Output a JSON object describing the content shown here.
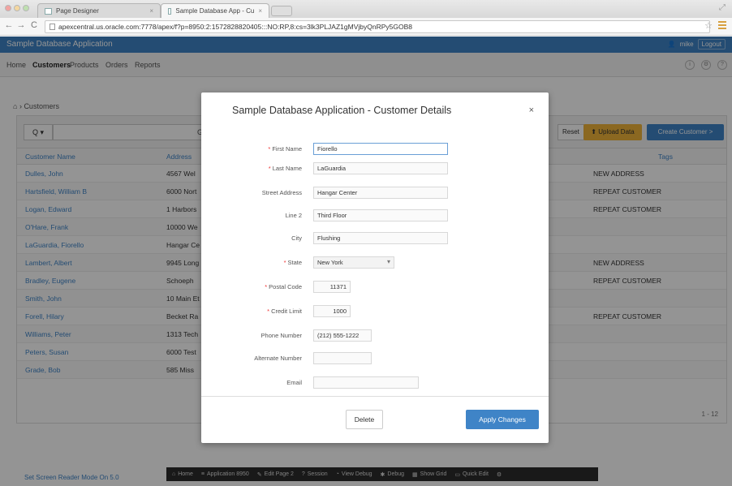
{
  "browser": {
    "tabs": [
      {
        "label": "Page Designer"
      },
      {
        "label": "Sample Database App - Cu"
      }
    ],
    "url": "apexcentral.us.oracle.com:7778/apex/f?p=8950:2:1572828820405:::NO:RP,8:cs=3lk3PLJAZ1gMVjbyQnRPy5GOB8"
  },
  "app": {
    "title": "Sample Database Application",
    "user": "mike",
    "logout": "Logout"
  },
  "nav": {
    "items": [
      "Home",
      "Customers",
      "Products",
      "Orders",
      "Reports"
    ],
    "active": "Customers"
  },
  "breadcrumb": "Customers",
  "report": {
    "search_button": "Q ▾",
    "go": "G",
    "reset": "Reset",
    "upload": "Upload Data",
    "create": "Create Customer >",
    "columns": [
      "Customer Name",
      "Address",
      "Tags"
    ],
    "rows": [
      {
        "name": "Dulles, John",
        "address": "4567 Wel",
        "tags": "NEW ADDRESS"
      },
      {
        "name": "Hartsfield, William B",
        "address": "6000 Nort",
        "tags": "REPEAT CUSTOMER"
      },
      {
        "name": "Logan, Edward",
        "address": "1 Harbors",
        "tags": "REPEAT CUSTOMER"
      },
      {
        "name": "O'Hare, Frank",
        "address": "10000 We",
        "tags": ""
      },
      {
        "name": "LaGuardia, Fiorello",
        "address": "Hangar Ce",
        "tags": ""
      },
      {
        "name": "Lambert, Albert",
        "address": "9945 Long",
        "tags": "NEW ADDRESS"
      },
      {
        "name": "Bradley, Eugene",
        "address": "Schoeph",
        "tags": "REPEAT CUSTOMER"
      },
      {
        "name": "Smith, John",
        "address": "10 Main Et",
        "tags": ""
      },
      {
        "name": "Forell, Hilary",
        "address": "Becket Ra",
        "tags": "REPEAT CUSTOMER"
      },
      {
        "name": "Williams, Peter",
        "address": "1313 Tech",
        "tags": ""
      },
      {
        "name": "Peters, Susan",
        "address": "6000 Test",
        "tags": ""
      },
      {
        "name": "Grade, Bob",
        "address": "585 Miss",
        "tags": ""
      }
    ],
    "pagination": "1 - 12"
  },
  "reader_link": "Set Screen Reader Mode On 5.0",
  "dialog": {
    "title": "Sample Database Application - Customer Details",
    "close": "×",
    "fields": [
      {
        "label": "First Name",
        "value": "Fiorello",
        "required": true
      },
      {
        "label": "Last Name",
        "value": "LaGuardia",
        "required": true
      },
      {
        "label": "Street Address",
        "value": "Hangar Center",
        "required": false
      },
      {
        "label": "Line 2",
        "value": "Third Floor",
        "required": false
      },
      {
        "label": "City",
        "value": "Flushing",
        "required": false
      },
      {
        "label": "State",
        "value": "New York",
        "required": true
      },
      {
        "label": "Postal Code",
        "value": "11371",
        "required": true
      },
      {
        "label": "Credit Limit",
        "value": "1000",
        "required": true
      },
      {
        "label": "Phone Number",
        "value": "(212) 555-1222",
        "required": false
      },
      {
        "label": "Alternate Number",
        "value": "",
        "required": false
      },
      {
        "label": "Email",
        "value": "",
        "required": false
      }
    ],
    "delete": "Delete",
    "apply": "Apply Changes"
  },
  "devbar": {
    "items": [
      "Home",
      "Application 8950",
      "Edit Page 2",
      "Session",
      "View Debug",
      "Debug",
      "Show Grid",
      "Quick Edit"
    ]
  },
  "colors": {
    "brand": "#3f84c7",
    "upload": "#efb43a",
    "required": "#ee3333"
  }
}
